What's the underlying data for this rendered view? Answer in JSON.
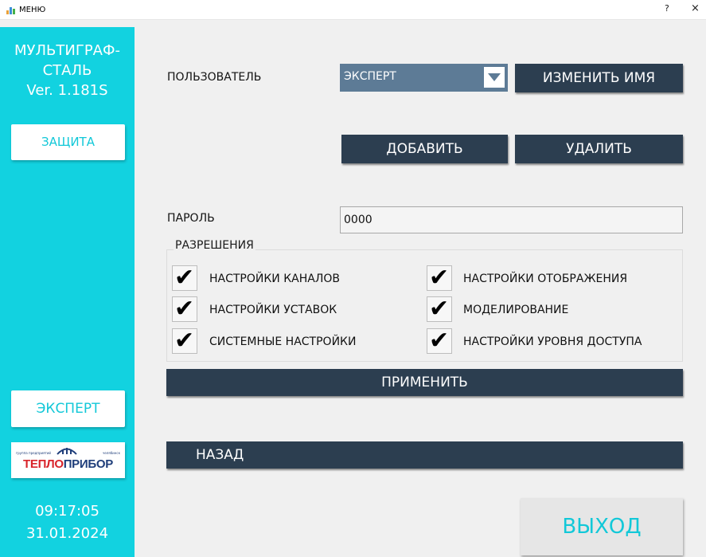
{
  "window": {
    "title": "МЕНЮ",
    "help": "?",
    "close": "×"
  },
  "sidebar": {
    "brand_line1": "МУЛЬТИГРАФ-",
    "brand_line2": "СТАЛЬ",
    "version": "Ver. 1.181S",
    "protect_label": "ЗАЩИТА",
    "current_user": "ЭКСПЕРТ",
    "logo": {
      "small_left": "группа предприятий",
      "small_right": "челябинск",
      "name_part1": "ТЕПЛО",
      "name_part2": "ПРИБОР"
    },
    "time": "09:17:05",
    "date": "31.01.2024"
  },
  "user": {
    "label": "ПОЛЬЗОВАТЕЛЬ",
    "selected": "ЭКСПЕРТ",
    "rename_label": "ИЗМЕНИТЬ ИМЯ",
    "add_label": "ДОБАВИТЬ",
    "delete_label": "УДАЛИТЬ"
  },
  "password": {
    "label": "ПАРОЛЬ",
    "value": "0000"
  },
  "permissions": {
    "title": "РАЗРЕШЕНИЯ",
    "items": [
      {
        "label": "НАСТРОЙКИ КАНАЛОВ",
        "checked": true
      },
      {
        "label": "НАСТРОЙКИ УСТАВОК",
        "checked": true
      },
      {
        "label": "СИСТЕМНЫЕ НАСТРОЙКИ",
        "checked": true
      },
      {
        "label": "НАСТРОЙКИ ОТОБРАЖЕНИЯ",
        "checked": true
      },
      {
        "label": "МОДЕЛИРОВАНИЕ",
        "checked": true
      },
      {
        "label": "НАСТРОЙКИ УРОВНЯ ДОСТУПА",
        "checked": true
      }
    ],
    "check_glyph": "✔"
  },
  "actions": {
    "apply_label": "ПРИМЕНИТЬ",
    "back_label": "НАЗАД",
    "exit_label": "ВЫХОД"
  },
  "colors": {
    "accent": "#12d2e0",
    "dark_button": "#2c3e50",
    "select": "#5d7b96",
    "logo_red": "#d8232a",
    "logo_blue": "#1f3e7a"
  }
}
